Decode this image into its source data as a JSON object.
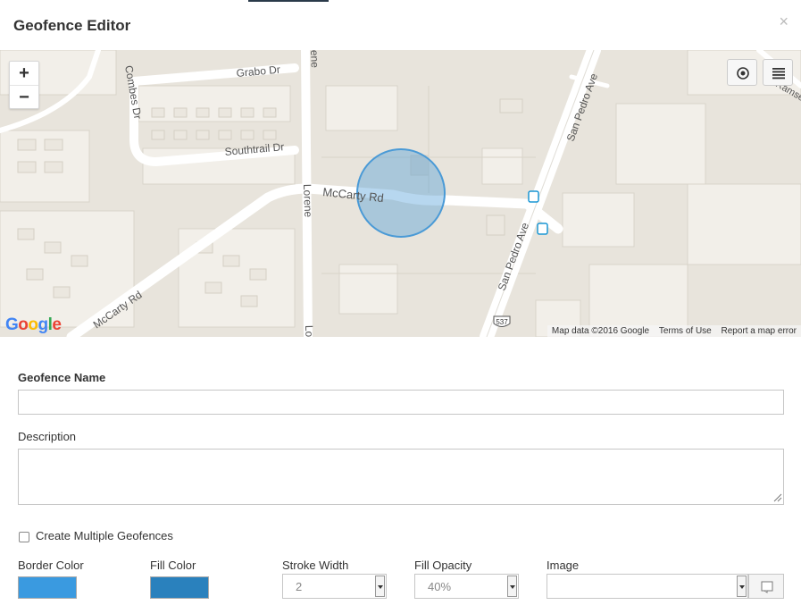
{
  "modal": {
    "title": "Geofence Editor",
    "close_icon": "close-icon",
    "close_glyph": "×"
  },
  "map": {
    "zoom_in": "+",
    "zoom_out": "−",
    "streets": [
      "Grabo Dr",
      "Combes Dr",
      "Southtrail Dr",
      "McCarty Rd",
      "McCarty Rd",
      "Lorene",
      "San Pedro Ave",
      "San Pedro Ave",
      "Ramsey",
      "Lorene",
      "ene"
    ],
    "route_shield": "537",
    "google_logo": {
      "g1": "G",
      "o1": "o",
      "o2": "o",
      "g2": "g",
      "l": "l",
      "e": "e"
    },
    "attribution": {
      "data": "Map data ©2016 Google",
      "terms": "Terms of Use",
      "report": "Report a map error"
    },
    "controls": {
      "locate_icon": "target-icon",
      "layers_icon": "layers-list-icon"
    },
    "geofence_circle": {
      "stroke": "#4a9ad6",
      "fill": "#4a9ad6"
    }
  },
  "form": {
    "name_label": "Geofence Name",
    "name_value": "",
    "description_label": "Description",
    "description_value": "",
    "multiple_label": "Create Multiple Geofences",
    "multiple_checked": false,
    "border_color_label": "Border Color",
    "border_color": "#3a9ae0",
    "fill_color_label": "Fill Color",
    "fill_color": "#2a81bd",
    "stroke_width_label": "Stroke Width",
    "stroke_width_value": "2",
    "fill_opacity_label": "Fill Opacity",
    "fill_opacity_value": "40%",
    "image_label": "Image",
    "image_value": "",
    "image_button_icon": "image-picker-icon"
  }
}
